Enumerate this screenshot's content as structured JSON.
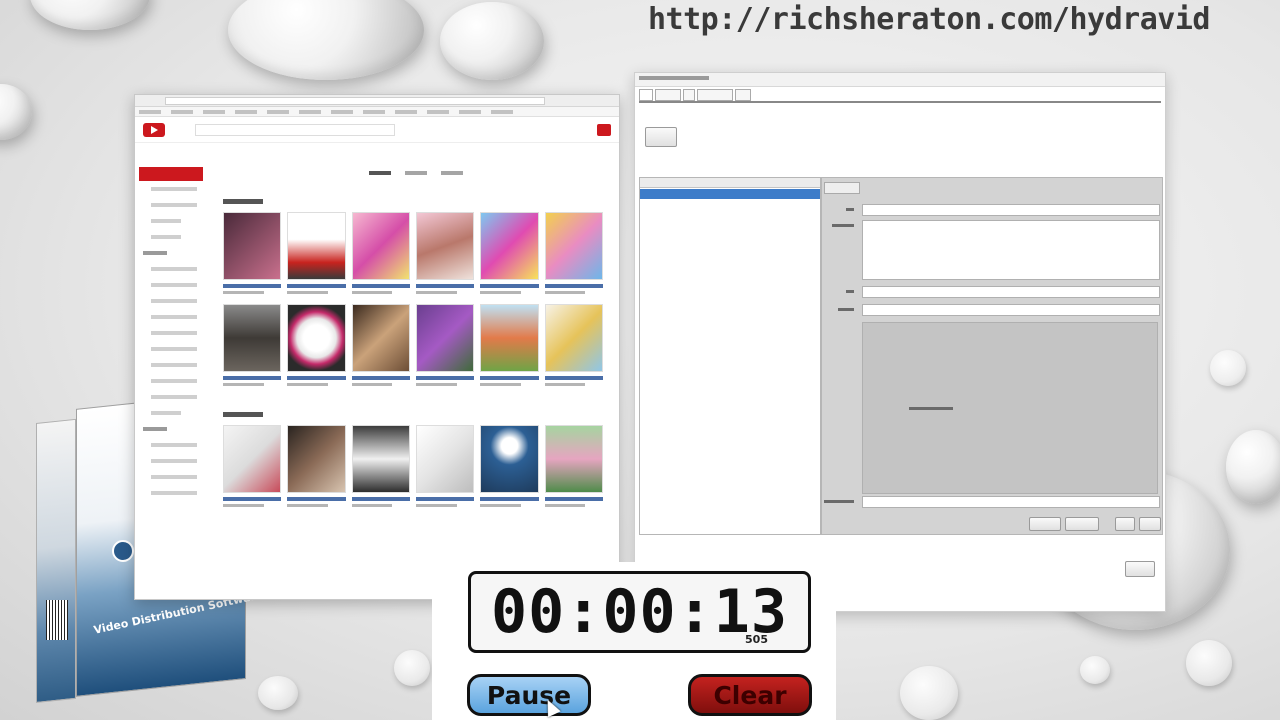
{
  "overlay": {
    "url": "http://richsheraton.com/hydravid"
  },
  "product": {
    "box_label": "Video Distribution Software"
  },
  "timer": {
    "elapsed": "00:00:13",
    "sub_value": "505",
    "pause_label": "Pause",
    "clear_label": "Clear"
  },
  "colors": {
    "youtube_red": "#cc181e",
    "selection_blue": "#3d7cc9",
    "pause_blue": "#5aa3de",
    "clear_red": "#9b1512"
  },
  "icons": [
    "youtube-logo-icon",
    "play-icon",
    "upload-icon",
    "mouse-cursor-icon"
  ]
}
